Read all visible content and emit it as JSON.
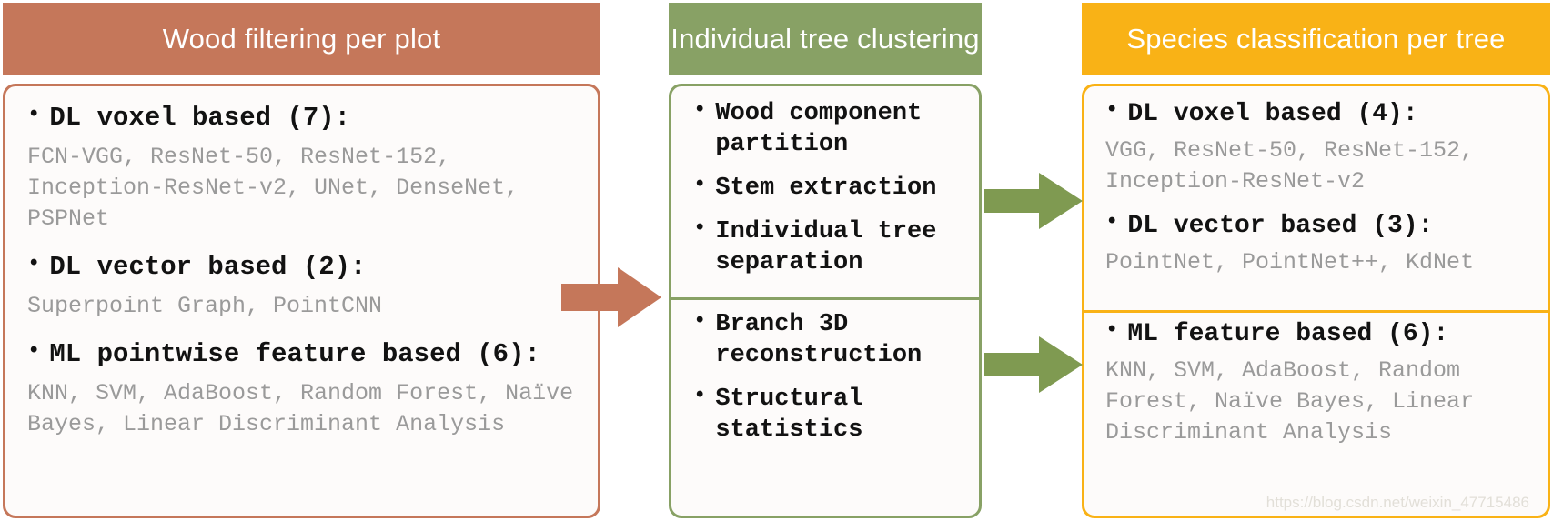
{
  "headers": [
    {
      "label": "Wood filtering per plot",
      "color": "#c5775a"
    },
    {
      "label": "Individual tree clustering",
      "color": "#88a165"
    },
    {
      "label": "Species classification per tree",
      "color": "#f9b216"
    }
  ],
  "columns": {
    "wood_filtering": {
      "accent": "#c5775a",
      "groups": [
        {
          "heading": "DL voxel based (7):",
          "methods": "FCN-VGG, ResNet-50, ResNet-152, Inception-ResNet-v2, UNet, DenseNet, PSPNet"
        },
        {
          "heading": "DL vector based (2):",
          "methods": "Superpoint Graph, PointCNN"
        },
        {
          "heading": "ML pointwise feature based (6):",
          "methods": "KNN, SVM, AdaBoost, Random Forest, Naïve Bayes, Linear Discriminant Analysis"
        }
      ]
    },
    "tree_clustering": {
      "accent": "#88a165",
      "top_items": [
        "Wood component partition",
        "Stem extraction",
        "Individual tree separation"
      ],
      "bottom_items": [
        "Branch 3D reconstruction",
        "Structural statistics"
      ]
    },
    "species_classification": {
      "accent": "#f9b216",
      "top_groups": [
        {
          "heading": "DL voxel based (4):",
          "methods": "VGG, ResNet-50, ResNet-152, Inception-ResNet-v2"
        },
        {
          "heading": "DL vector based (3):",
          "methods": "PointNet, PointNet++, KdNet"
        }
      ],
      "bottom_groups": [
        {
          "heading": "ML feature based (6):",
          "methods": "KNN, SVM, AdaBoost, Random Forest, Naïve Bayes, Linear Discriminant Analysis"
        }
      ]
    }
  },
  "arrows": [
    {
      "name": "arrow-wood-to-clustering",
      "color": "#c5775a"
    },
    {
      "name": "arrow-clustering-to-species-top",
      "color": "#7f9a51"
    },
    {
      "name": "arrow-clustering-to-species-bot",
      "color": "#7f9a51"
    }
  ],
  "bullet_glyph": "•",
  "watermark": "https://blog.csdn.net/weixin_47715486"
}
